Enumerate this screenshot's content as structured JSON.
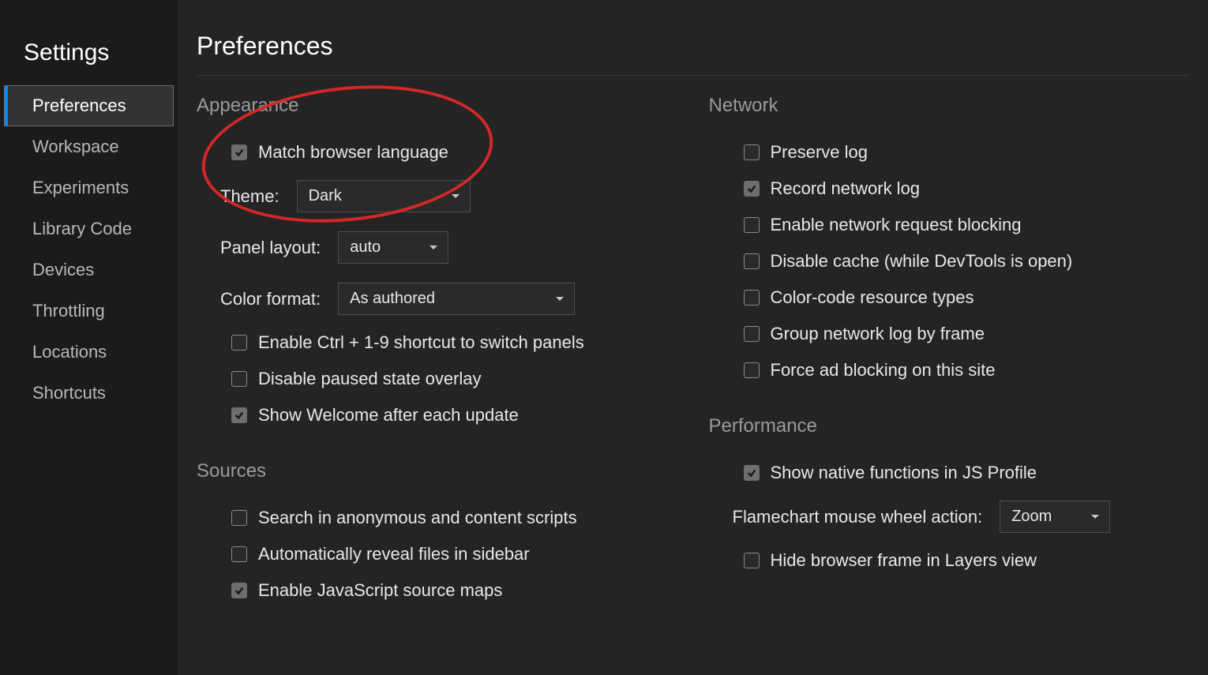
{
  "sidebar": {
    "title": "Settings",
    "items": [
      {
        "label": "Preferences",
        "selected": true
      },
      {
        "label": "Workspace",
        "selected": false
      },
      {
        "label": "Experiments",
        "selected": false
      },
      {
        "label": "Library Code",
        "selected": false
      },
      {
        "label": "Devices",
        "selected": false
      },
      {
        "label": "Throttling",
        "selected": false
      },
      {
        "label": "Locations",
        "selected": false
      },
      {
        "label": "Shortcuts",
        "selected": false
      }
    ]
  },
  "page": {
    "title": "Preferences"
  },
  "appearance": {
    "heading": "Appearance",
    "match_browser_language": {
      "label": "Match browser language",
      "checked": true
    },
    "theme": {
      "label": "Theme:",
      "value": "Dark"
    },
    "panel_layout": {
      "label": "Panel layout:",
      "value": "auto"
    },
    "color_format": {
      "label": "Color format:",
      "value": "As authored"
    },
    "enable_ctrl_shortcut": {
      "label": "Enable Ctrl + 1-9 shortcut to switch panels",
      "checked": false
    },
    "disable_paused_overlay": {
      "label": "Disable paused state overlay",
      "checked": false
    },
    "show_welcome": {
      "label": "Show Welcome after each update",
      "checked": true
    }
  },
  "sources": {
    "heading": "Sources",
    "search_anonymous": {
      "label": "Search in anonymous and content scripts",
      "checked": false
    },
    "auto_reveal": {
      "label": "Automatically reveal files in sidebar",
      "checked": false
    },
    "enable_js_sourcemaps": {
      "label": "Enable JavaScript source maps",
      "checked": true
    }
  },
  "network": {
    "heading": "Network",
    "preserve_log": {
      "label": "Preserve log",
      "checked": false
    },
    "record_network_log": {
      "label": "Record network log",
      "checked": true
    },
    "enable_request_blocking": {
      "label": "Enable network request blocking",
      "checked": false
    },
    "disable_cache": {
      "label": "Disable cache (while DevTools is open)",
      "checked": false
    },
    "color_code_types": {
      "label": "Color-code resource types",
      "checked": false
    },
    "group_by_frame": {
      "label": "Group network log by frame",
      "checked": false
    },
    "force_ad_blocking": {
      "label": "Force ad blocking on this site",
      "checked": false
    }
  },
  "performance": {
    "heading": "Performance",
    "show_native_functions": {
      "label": "Show native functions in JS Profile",
      "checked": true
    },
    "flamechart_wheel": {
      "label": "Flamechart mouse wheel action:",
      "value": "Zoom"
    },
    "hide_browser_frame": {
      "label": "Hide browser frame in Layers view",
      "checked": false
    }
  },
  "annotation": {
    "circle_highlight": true
  }
}
